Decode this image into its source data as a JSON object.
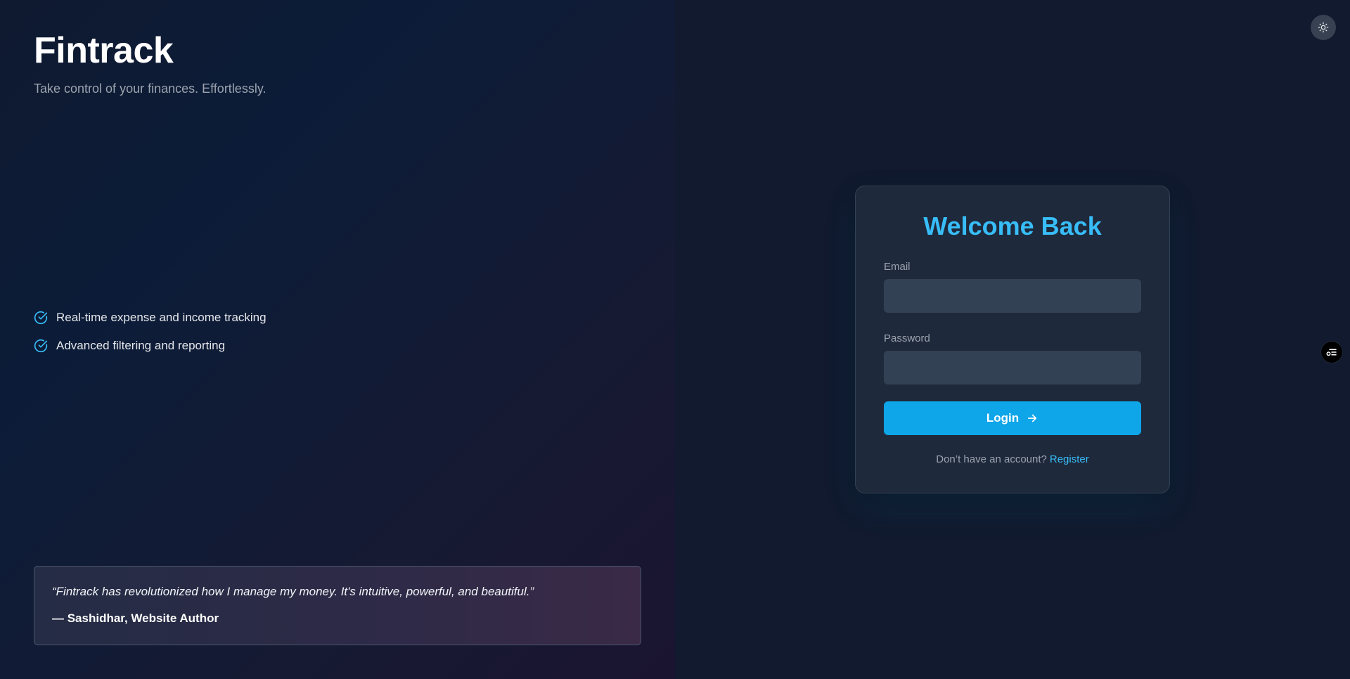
{
  "brand": {
    "title": "Fintrack",
    "tagline": "Take control of your finances. Effortlessly."
  },
  "features": [
    {
      "label": "Real-time expense and income tracking",
      "icon": "check-circle-icon"
    },
    {
      "label": "Advanced filtering and reporting",
      "icon": "check-circle-icon"
    }
  ],
  "testimonial": {
    "quote": "“Fintrack has revolutionized how I manage my money. It's intuitive, powerful, and beautiful.”",
    "author": "— Sashidhar, Website Author"
  },
  "login": {
    "title": "Welcome Back",
    "email_label": "Email",
    "email_value": "",
    "password_label": "Password",
    "password_value": "",
    "submit_label": "Login",
    "register_prompt": "Don’t have an account?",
    "register_link": "Register"
  },
  "controls": {
    "theme_toggle_icon": "sun-icon",
    "side_widget_icon": "list-settings-icon"
  },
  "colors": {
    "accent": "#38bdf8",
    "button": "#0ea5e9",
    "card": "#1e293b",
    "input": "#334155"
  }
}
